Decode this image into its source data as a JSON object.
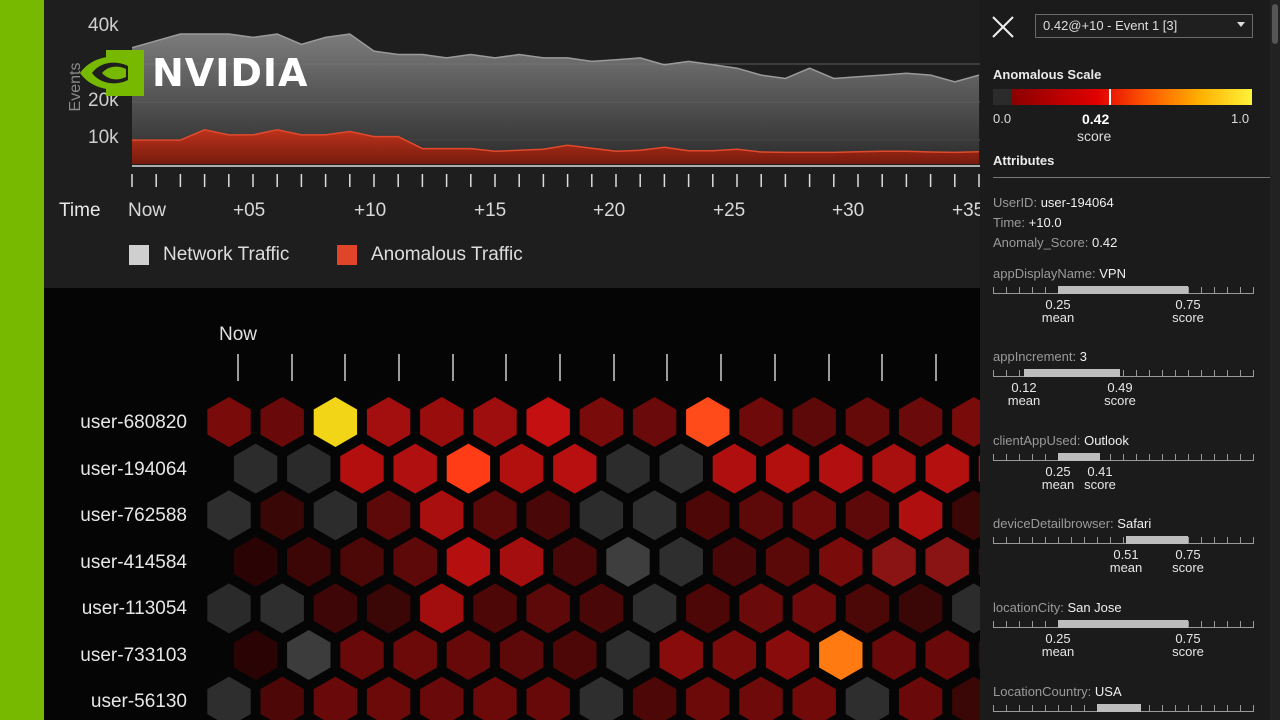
{
  "brand": {
    "name": "NVIDIA",
    "accent": "#76b900"
  },
  "traffic_chart": {
    "y_axis_label": "Events",
    "y_ticks": [
      "40k",
      "20k",
      "10k"
    ],
    "time_title": "Time",
    "time_labels": [
      "Now",
      "+05",
      "+10",
      "+15",
      "+20",
      "+25",
      "+30",
      "+35"
    ],
    "legend": [
      {
        "label": "Network Traffic",
        "color": "#cfcfcf"
      },
      {
        "label": "Anomalous Traffic",
        "color": "#e0452a"
      }
    ],
    "chart_data": {
      "type": "area",
      "x": [
        0,
        1,
        2,
        3,
        4,
        5,
        6,
        7,
        8,
        9,
        10,
        11,
        12,
        13,
        14,
        15,
        16,
        17,
        18,
        19,
        20,
        21,
        22,
        23,
        24,
        25,
        26,
        27,
        28,
        29,
        30,
        31,
        32,
        33,
        34,
        35
      ],
      "series": [
        {
          "name": "Network Traffic",
          "values": [
            39000,
            41000,
            43000,
            43000,
            43000,
            42000,
            43000,
            40000,
            42000,
            43000,
            38000,
            37000,
            37000,
            36000,
            37000,
            36000,
            37000,
            36000,
            36000,
            35000,
            35500,
            36000,
            34000,
            35000,
            34000,
            33000,
            31000,
            30000,
            33000,
            30000,
            30500,
            31000,
            31500,
            31000,
            29000,
            31000
          ]
        },
        {
          "name": "Anomalous Traffic",
          "values": [
            12000,
            12000,
            12000,
            15000,
            13500,
            13500,
            15000,
            13500,
            13500,
            14500,
            13000,
            13000,
            9500,
            9500,
            9500,
            8700,
            9000,
            9300,
            10500,
            9600,
            8700,
            9000,
            9900,
            8900,
            8900,
            9300,
            8500,
            8400,
            8400,
            8400,
            8600,
            8700,
            8700,
            8500,
            8400,
            8600
          ]
        }
      ],
      "xlabel": "Time",
      "ylabel": "Events"
    }
  },
  "hex_grid": {
    "now_label": "Now",
    "users": [
      "user-680820",
      "user-194064",
      "user-762588",
      "user-414584",
      "user-113054",
      "user-733103",
      "user-56130"
    ],
    "cells": [
      [
        "#7a0b0b",
        "#6a0909",
        "#f2d516",
        "#a30f0f",
        "#9a0d0d",
        "#9e0e0e",
        "#c41010",
        "#7a0b0b",
        "#6a0a0a",
        "#ff4a1a",
        "#6e0a0a",
        "#5e0909",
        "#650909",
        "#6a0a0a",
        "#7a0b0b"
      ],
      [
        "#2c2c2c",
        "#2a2a2a",
        "#b40f0f",
        "#b01010",
        "#ff3c16",
        "#b20f0f",
        "#b81010",
        "#2c2c2c",
        "#2e2e2e",
        "#b00f0f",
        "#b20f0f",
        "#b21010",
        "#a80f0f",
        "#b51010",
        "#b00f0f"
      ],
      [
        "#2e2e2e",
        "#3a0707",
        "#2c2c2c",
        "#5e0909",
        "#aa0f0f",
        "#5a0808",
        "#4a0707",
        "#2c2c2c",
        "#2e2e2e",
        "#4e0707",
        "#5e0909",
        "#6c0a0a",
        "#5e0909",
        "#b00f0f",
        "#3b0606"
      ],
      [
        "#2a0404",
        "#3c0606",
        "#4c0707",
        "#5e0909",
        "#b50f0f",
        "#a50e0e",
        "#4a0707",
        "#3e3e3e",
        "#2e2e2e",
        "#4a0707",
        "#5a0808",
        "#7a0b0b",
        "#8a1414",
        "#8a1414",
        "#4e0707"
      ],
      [
        "#2a2a2a",
        "#2e2e2e",
        "#3e0606",
        "#3a0606",
        "#a20e0e",
        "#4e0707",
        "#5e0909",
        "#4a0707",
        "#2e2e2e",
        "#4e0707",
        "#6a0a0a",
        "#6e0a0a",
        "#4c0707",
        "#3a0606",
        "#2c2c2c"
      ],
      [
        "#2a0404",
        "#3c3c3c",
        "#6a0909",
        "#6c0a0a",
        "#680909",
        "#5e0909",
        "#4e0707",
        "#2e2e2e",
        "#880c0c",
        "#7a0b0b",
        "#880c0c",
        "#ff7a10",
        "#6a0909",
        "#6a0909",
        "#3a0606"
      ],
      [
        "#2e2e2e",
        "#4e0707",
        "#6a0909",
        "#6c0a0a",
        "#6a0909",
        "#6c0a0a",
        "#680909",
        "#2e2e2e",
        "#4e0707",
        "#6c0a0a",
        "#6e0a0a",
        "#720a0a",
        "#2e2e2e",
        "#6a0909",
        "#3a0606"
      ]
    ]
  },
  "side_panel": {
    "event_select": "0.42@+10 - Event 1 [3]",
    "anomalous_scale": {
      "title": "Anomalous Scale",
      "min": "0.0",
      "max": "1.0",
      "value": "0.42",
      "value_caption": "score",
      "value_fraction": 0.42
    },
    "attributes_title": "Attributes",
    "info": [
      {
        "key": "UserID:",
        "value": "user-194064"
      },
      {
        "key": "Time:",
        "value": "+10.0"
      },
      {
        "key": "Anomaly_Score:",
        "value": "0.42"
      }
    ],
    "attributes": [
      {
        "name": "appDisplayName:",
        "value": "VPN",
        "mean": "0.25",
        "score": "0.75",
        "mean_label": "mean",
        "score_label": "score",
        "mean_f": 0.25,
        "score_f": 0.75
      },
      {
        "name": "appIncrement:",
        "value": "3",
        "mean": "0.12",
        "score": "0.49",
        "mean_label": "mean",
        "score_label": "score",
        "mean_f": 0.12,
        "score_f": 0.49
      },
      {
        "name": "clientAppUsed:",
        "value": "Outlook",
        "mean": "0.25",
        "score": "0.41",
        "mean_label": "mean",
        "score_label": "score",
        "mean_f": 0.25,
        "score_f": 0.41
      },
      {
        "name": "deviceDetailbrowser:",
        "value": "Safari",
        "mean": "0.51",
        "score": "0.75",
        "mean_label": "mean",
        "score_label": "score",
        "mean_f": 0.51,
        "score_f": 0.75
      },
      {
        "name": "locationCity:",
        "value": "San Jose",
        "mean": "0.25",
        "score": "0.75",
        "mean_label": "mean",
        "score_label": "score",
        "mean_f": 0.25,
        "score_f": 0.75
      },
      {
        "name": "LocationCountry:",
        "value": "USA",
        "mean": "",
        "score": "",
        "mean_label": "",
        "score_label": "",
        "mean_f": 0.4,
        "score_f": 0.57
      }
    ]
  }
}
